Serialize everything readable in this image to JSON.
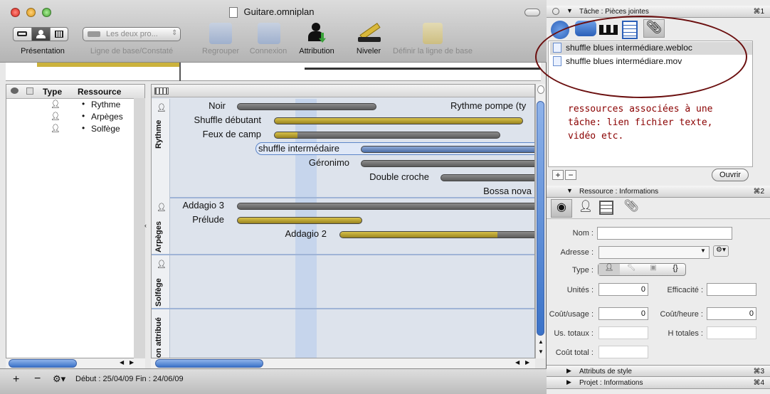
{
  "window": {
    "title": "Guitare.omniplan"
  },
  "toolbar": {
    "presentation_label": "Présentation",
    "baseline_select": "Les deux pro...",
    "baseline_label": "Ligne de base/Constaté",
    "group_label": "Regrouper",
    "connect_label": "Connexion",
    "assign_label": "Attribution",
    "level_label": "Niveler",
    "set_baseline_label": "Définir la ligne de base"
  },
  "left_pane": {
    "col_type": "Type",
    "col_resource": "Ressource",
    "rows": [
      {
        "name": "Rythme",
        "selected": false
      },
      {
        "name": "Arpèges",
        "selected": true
      },
      {
        "name": "Solfège",
        "selected": false
      }
    ]
  },
  "chart": {
    "lanes": [
      {
        "name": "Rythme"
      },
      {
        "name": "Arpèges"
      },
      {
        "name": "Solfège"
      },
      {
        "name": "on attribué"
      }
    ],
    "tasks": [
      {
        "name": "Noir"
      },
      {
        "name": "Rythme pompe (ty"
      },
      {
        "name": "Shuffle débutant"
      },
      {
        "name": "Feux de camp"
      },
      {
        "name": "shuffle intermédaire"
      },
      {
        "name": "Géronimo"
      },
      {
        "name": "Double croche"
      },
      {
        "name": "Bossa nova"
      },
      {
        "name": "Addagio 3"
      },
      {
        "name": "Prélude"
      },
      {
        "name": "Addagio 2"
      }
    ]
  },
  "status": {
    "text": "Début : 25/04/09 Fin : 24/06/09"
  },
  "inspector": {
    "task_header": {
      "title": "Tâche : Pièces jointes",
      "shortcut": "⌘1"
    },
    "attachments": [
      "shuffle blues intermédiare.webloc",
      "shuffle blues intermédiare.mov"
    ],
    "open_button": "Ouvrir",
    "resource_header": {
      "title": "Ressource : Informations",
      "shortcut": "⌘2"
    },
    "fields": {
      "name_label": "Nom :",
      "address_label": "Adresse :",
      "type_label": "Type :",
      "units_label": "Unités :",
      "units_value": "0",
      "efficiency_label": "Efficacité :",
      "cost_use_label": "Coût/usage :",
      "cost_use_value": "0",
      "cost_hour_label": "Coût/heure :",
      "cost_hour_value": "0",
      "total_use_label": "Us. totaux :",
      "total_hours_label": "H totales :",
      "total_cost_label": "Coût total :"
    },
    "style_header": {
      "title": "Attributs de style",
      "shortcut": "⌘3"
    },
    "project_header": {
      "title": "Projet : Informations",
      "shortcut": "⌘4"
    }
  },
  "annotation": {
    "text": "ressources associées à une tâche: lien fichier texte, vidéo etc."
  }
}
